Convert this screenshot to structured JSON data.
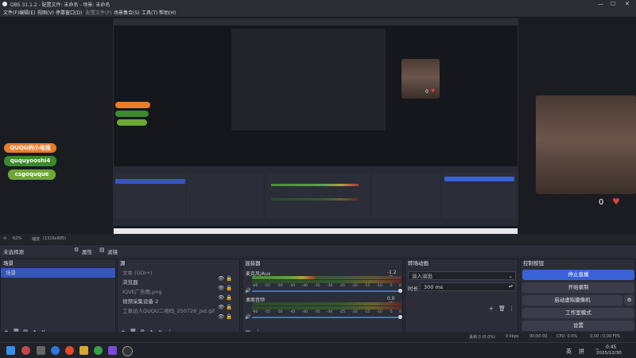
{
  "window": {
    "title": "OBS 31.1.2 - 配置文件: 未命名 - 场景: 未命名"
  },
  "menu": [
    "文件(F)",
    "编辑(E)",
    "视图(V)",
    "停靠窗口(D)",
    "配置文件(P)",
    "场景集合(S)",
    "工具(T)",
    "帮助(H)"
  ],
  "overlay": {
    "badge1": "QUQU的小电视",
    "badge2": "ququyooshi4",
    "badge3": "csgoquque",
    "count1": "0",
    "count2": "0",
    "count3": "0"
  },
  "statusbar": {
    "zoom": "62%",
    "res_label": "缩放",
    "res": "(1316x685)"
  },
  "docks": {
    "source_tab": "未选择源",
    "properties": "属性",
    "filters": "滤镜"
  },
  "scenes": {
    "header": "场景",
    "items": [
      "场景"
    ]
  },
  "sources": {
    "header": "源",
    "items": [
      "文本 (GDI+)",
      "浏览器",
      "IQVE广告图.png",
      "视频采集设备 2",
      "工录达人QUQU二维码_250726_jsd.gif"
    ]
  },
  "mixer": {
    "header": "混音器",
    "channels": [
      {
        "name": "麦克风/Aux",
        "db": "-1.2 dB",
        "level": 0.42
      },
      {
        "name": "桌面音频",
        "db": "0.0 dB",
        "level": 0.0
      }
    ],
    "scale": [
      "-60",
      "-55",
      "-50",
      "-45",
      "-40",
      "-35",
      "-30",
      "-25",
      "-20",
      "-15",
      "-10",
      "-5",
      "0"
    ]
  },
  "transitions": {
    "header": "转场动画",
    "type": "淡入淡出",
    "duration_label": "时长",
    "duration": "300 ms"
  },
  "controls": {
    "header": "控制按钮",
    "buttons": [
      "停止直播",
      "开始录制",
      "启动虚拟摄像机",
      "工作室模式",
      "设置"
    ]
  },
  "stats": {
    "dropped": "丢帧 0 (0.0%)",
    "kbps": "0 kbps",
    "live": "00:00:00",
    "rec": "00:00:00",
    "cpu": "CPU: 0.0%",
    "fps": "0.00 / 0.00 FPS"
  },
  "taskbar": {
    "time": "0:45",
    "date": "2025/12/30",
    "tray": [
      "英",
      "拼"
    ]
  },
  "colors": {
    "accent": "#3a62d8",
    "bg": "#272a33",
    "meter_green": "#5aa24a"
  }
}
